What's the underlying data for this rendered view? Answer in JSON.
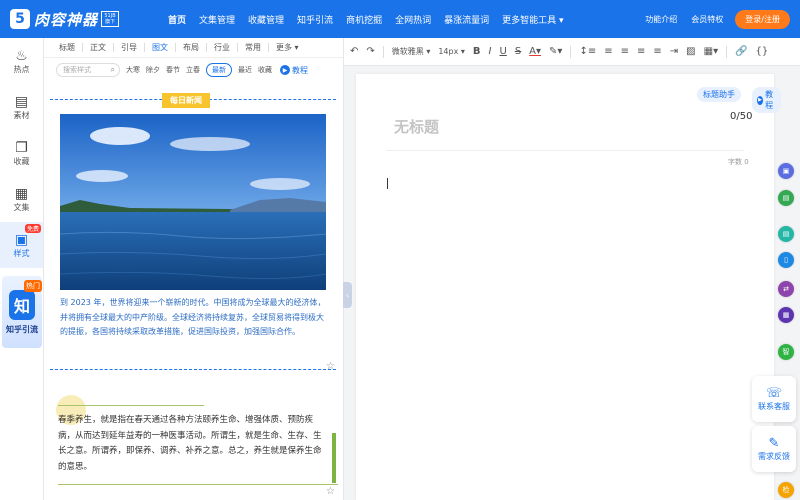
{
  "header": {
    "logo_mark": "5",
    "logo_text": "肉容神器",
    "logo_badge": "51JB旗下",
    "nav": [
      "首页",
      "文集管理",
      "收藏管理",
      "知乎引流",
      "商机挖掘",
      "全网热词",
      "暴涨流量词",
      "更多智能工具 ▾"
    ],
    "links": [
      "功能介绍",
      "会员特权"
    ],
    "login": "登录/注册"
  },
  "rail": {
    "items": [
      {
        "label": "热点",
        "icon": "flame-icon",
        "glyph": "🔥"
      },
      {
        "label": "素材",
        "icon": "image-icon",
        "glyph": "▤"
      },
      {
        "label": "收藏",
        "icon": "bookmark-icon",
        "glyph": "❐"
      },
      {
        "label": "文集",
        "icon": "document-icon",
        "glyph": "▦"
      },
      {
        "label": "样式",
        "icon": "style-icon",
        "glyph": "▣"
      }
    ],
    "free_badge": "免费",
    "zhihu": {
      "logo": "知",
      "hot": "热门",
      "label": "知乎引流"
    }
  },
  "styles_panel": {
    "tabs": [
      "标题",
      "正文",
      "引导",
      "图文",
      "布局",
      "行业",
      "常用",
      "更多 ▾"
    ],
    "active_tab": 3,
    "search_placeholder": "搜索样式",
    "filters": [
      "大寒",
      "除夕",
      "春节",
      "立春"
    ],
    "sort": [
      "最新",
      "最近",
      "收藏"
    ],
    "tutorial": "教程",
    "card1": {
      "tag": "每日新闻",
      "text": "到 2023 年，世界将迎来一个崭新的时代。中国将成为全球最大的经济体，并将拥有全球最大的中产阶级。全球经济将持续复苏，全球贸易将得到极大的提振，各国将持续采取改革措施，促进国际投资，加强国际合作。"
    },
    "card2": {
      "text": "春季养生，就是指在春天通过各种方法颐养生命、增强体质、预防疾病，从而达到延年益寿的一种医事活动。所谓生，就是生命、生存、生长之意。所谓养，即保养、调养、补养之意。总之，养生就是保养生命的意思。"
    }
  },
  "toolbar": {
    "font": "微软雅黑 ▾",
    "size": "14px ▾"
  },
  "editor": {
    "title_helper": "标题助手",
    "tutorial": "教程",
    "title_placeholder": "无标题",
    "title_count": "0/50",
    "word_count": "字数 0"
  },
  "float_buttons": {
    "service": "联系客服",
    "feedback": "需求反馈"
  },
  "colors": {
    "brand": "#1a73e8",
    "accent": "#ff7a1a"
  }
}
